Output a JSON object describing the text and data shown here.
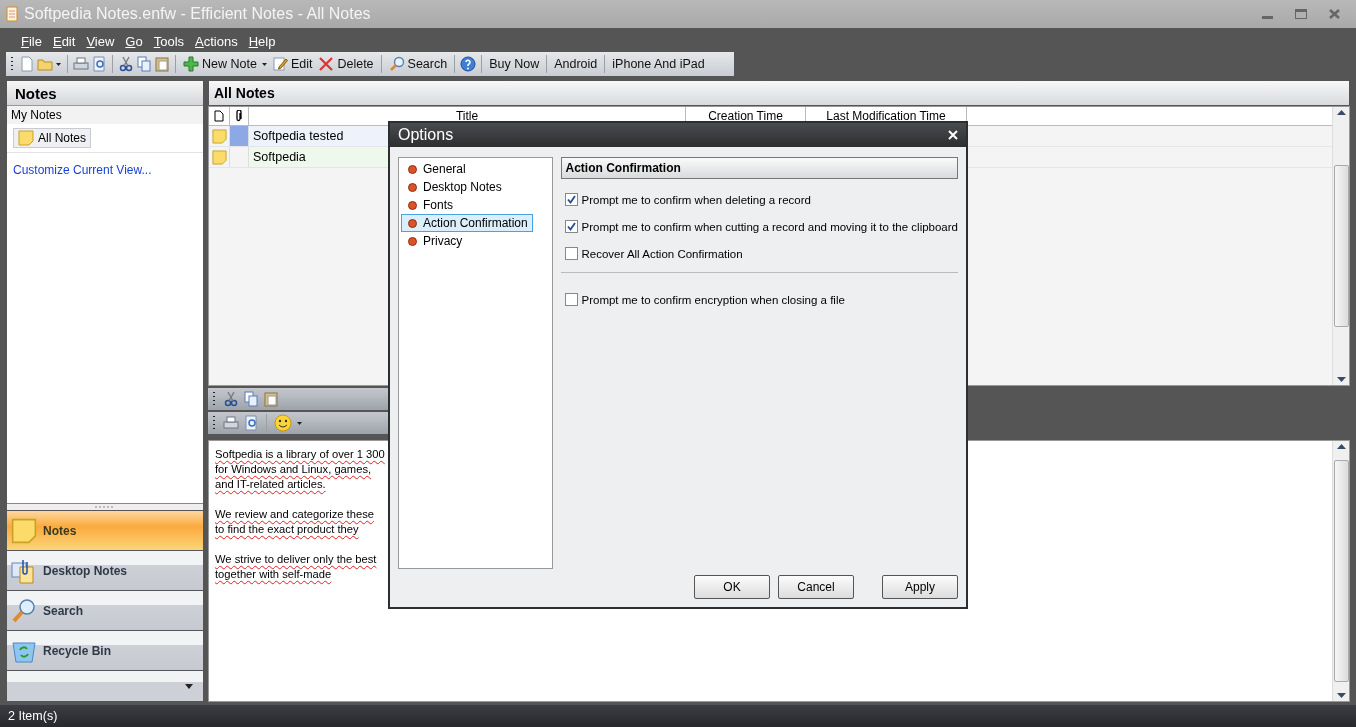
{
  "window": {
    "title": "Softpedia Notes.enfw - Efficient Notes - All Notes"
  },
  "menu": [
    "File",
    "Edit",
    "View",
    "Go",
    "Tools",
    "Actions",
    "Help"
  ],
  "toolbar": [
    "New Note",
    "Edit",
    "Delete",
    "Search",
    "Buy Now",
    "Android",
    "iPhone And iPad"
  ],
  "sidebar": {
    "title": "Notes",
    "group": "My Notes",
    "folder": {
      "label": "All Notes",
      "selected": true
    },
    "link": "Customize Current View...",
    "nav": [
      {
        "label": "Notes",
        "selected": true
      },
      {
        "label": "Desktop Notes",
        "selected": false
      },
      {
        "label": "Search",
        "selected": false
      },
      {
        "label": "Recycle Bin",
        "selected": false
      }
    ]
  },
  "list": {
    "title": "All Notes",
    "columns": [
      "Title",
      "Creation Time",
      "Last Modification Time"
    ],
    "rows": [
      {
        "title": "Softpedia tested",
        "selected": true
      },
      {
        "title": "Softpedia",
        "selected": false
      }
    ]
  },
  "editor": {
    "paragraphs": [
      [
        "Softpedia is a library of over 1 300",
        "for Windows and Linux, games,",
        "and IT-related articles."
      ],
      [
        "We review and categorize these",
        "to find the exact product they"
      ],
      [
        "We strive to deliver only the best",
        "together with self-made"
      ]
    ]
  },
  "dialog": {
    "title": "Options",
    "categories": [
      {
        "label": "General",
        "selected": false
      },
      {
        "label": "Desktop Notes",
        "selected": false
      },
      {
        "label": "Fonts",
        "selected": false
      },
      {
        "label": "Action Confirmation",
        "selected": true
      },
      {
        "label": "Privacy",
        "selected": false
      }
    ],
    "section": "Action Confirmation",
    "groups": [
      [
        {
          "label": "Prompt me to confirm when deleting a record",
          "checked": true
        },
        {
          "label": "Prompt me to confirm when cutting a record and moving it to the clipboard",
          "checked": true
        },
        {
          "label": "Recover All Action Confirmation",
          "checked": false
        }
      ],
      [
        {
          "label": "Prompt me to confirm encryption when closing a file",
          "checked": false
        }
      ]
    ],
    "buttons": [
      "OK",
      "Cancel",
      "Apply"
    ]
  },
  "status_bar": "2 Item(s)"
}
